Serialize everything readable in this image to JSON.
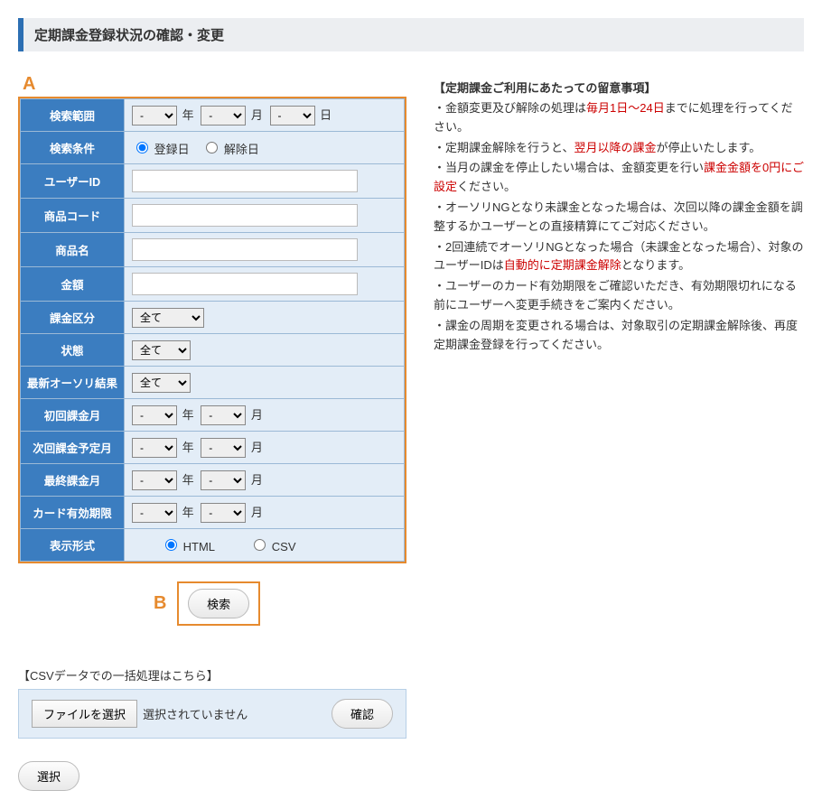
{
  "page": {
    "title": "定期課金登録状況の確認・変更"
  },
  "callouts": {
    "a": "A",
    "b": "B"
  },
  "form": {
    "rows": {
      "search_range": {
        "label": "検索範囲",
        "y": "年",
        "m": "月",
        "d": "日",
        "dash": "-"
      },
      "search_cond": {
        "label": "検索条件",
        "opt_reg": "登録日",
        "opt_cancel": "解除日"
      },
      "user_id": {
        "label": "ユーザーID"
      },
      "product_code": {
        "label": "商品コード"
      },
      "product_name": {
        "label": "商品名"
      },
      "amount": {
        "label": "金額"
      },
      "charge_class": {
        "label": "課金区分",
        "value": "全て"
      },
      "status": {
        "label": "状態",
        "value": "全て"
      },
      "auth_result": {
        "label": "最新オーソリ結果",
        "value": "全て"
      },
      "first_month": {
        "label": "初回課金月",
        "y": "年",
        "m": "月",
        "dash": "-"
      },
      "next_month": {
        "label": "次回課金予定月",
        "y": "年",
        "m": "月",
        "dash": "-"
      },
      "last_month": {
        "label": "最終課金月",
        "y": "年",
        "m": "月",
        "dash": "-"
      },
      "card_exp": {
        "label": "カード有効期限",
        "y": "年",
        "m": "月",
        "dash": "-"
      },
      "view_format": {
        "label": "表示形式",
        "opt_html": "HTML",
        "opt_csv": "CSV"
      }
    }
  },
  "search_button": "検索",
  "notes": {
    "title": "【定期課金ご利用にあたっての留意事項】",
    "l1a": "・金額変更及び解除の処理は",
    "l1b": "毎月1日～24日",
    "l1c": "までに処理を行ってください。",
    "l2a": "・定期課金解除を行うと、",
    "l2b": "翌月以降の課金",
    "l2c": "が停止いたします。",
    "l3a": "・当月の課金を停止したい場合は、金額変更を行い",
    "l3b": "課金金額を0円にご設定",
    "l3c": "ください。",
    "l4": "・オーソリNGとなり未課金となった場合は、次回以降の課金金額を調整するかユーザーとの直接精算にてご対応ください。",
    "l5a": "・2回連続でオーソリNGとなった場合（未課金となった場合）、対象のユーザーIDは",
    "l5b": "自動的に定期課金解除",
    "l5c": "となります。",
    "l6": "・ユーザーのカード有効期限をご確認いただき、有効期限切れになる前にユーザーへ変更手続きをご案内ください。",
    "l7": "・課金の周期を変更される場合は、対象取引の定期課金解除後、再度定期課金登録を行ってください。"
  },
  "csv": {
    "title": "【CSVデータでの一括処理はこちら】",
    "choose_file": "ファイルを選択",
    "no_file": "選択されていません",
    "confirm": "確認"
  },
  "select_button": "選択"
}
